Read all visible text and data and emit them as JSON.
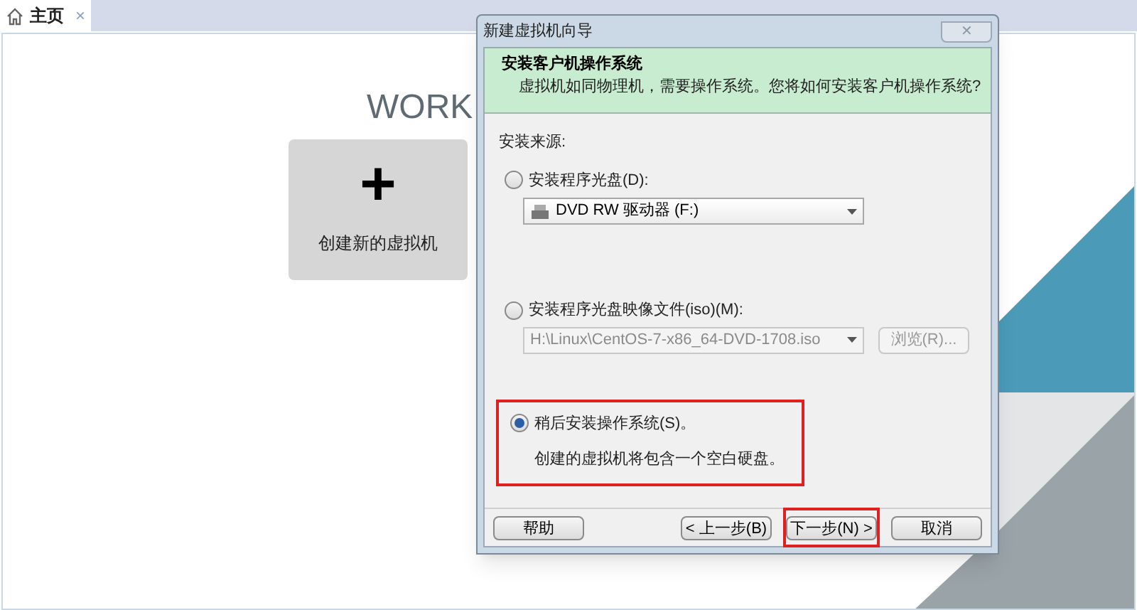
{
  "tabs": [
    {
      "label": "主页",
      "selected": true,
      "close": "×"
    }
  ],
  "home": {
    "title": "WORK",
    "card": {
      "icon": "+",
      "label": "创建新的虚拟机"
    }
  },
  "dialog": {
    "title": "新建虚拟机向导",
    "close": "✕",
    "header": {
      "title": "安装客户机操作系统",
      "subtitle": "虚拟机如同物理机，需要操作系统。您将如何安装客户机操作系统?"
    },
    "source_label": "安装来源:",
    "options": [
      {
        "kind": "disc",
        "label": "安装程序光盘(D):",
        "selected": false,
        "highlighted": false,
        "combo": {
          "value": "DVD RW 驱动器 (F:)",
          "disabled": false
        }
      },
      {
        "kind": "iso",
        "label": "安装程序光盘映像文件(iso)(M):",
        "selected": false,
        "highlighted": false,
        "combo": {
          "value": "H:\\Linux\\CentOS-7-x86_64-DVD-1708.iso",
          "disabled": true
        },
        "browse": {
          "label": "浏览(R)...",
          "disabled": true
        }
      },
      {
        "kind": "later",
        "label": "稍后安装操作系统(S)。",
        "selected": true,
        "highlighted": true,
        "note": "创建的虚拟机将包含一个空白硬盘。"
      }
    ],
    "buttons": [
      {
        "label": "帮助",
        "highlighted": false
      },
      {
        "label": "< 上一步(B)",
        "highlighted": false
      },
      {
        "label": "下一步(N) >",
        "highlighted": true
      },
      {
        "label": "取消",
        "highlighted": false
      }
    ]
  }
}
